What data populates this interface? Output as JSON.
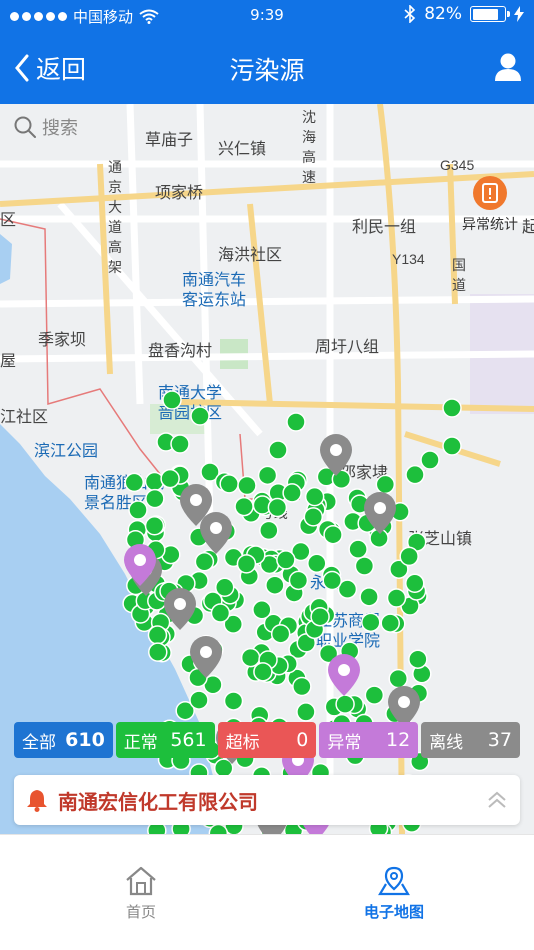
{
  "status_bar": {
    "carrier": "中国移动",
    "time": "9:39",
    "battery": "82%",
    "battery_level": 0.82
  },
  "nav": {
    "back_label": "返回",
    "title": "污染源"
  },
  "search": {
    "placeholder": "搜索"
  },
  "map": {
    "labels": [
      {
        "text": "草庙子",
        "type": "place"
      },
      {
        "text": "兴仁镇",
        "type": "place"
      },
      {
        "text": "沈海高速",
        "type": "road"
      },
      {
        "text": "项家桥",
        "type": "place"
      },
      {
        "text": "通京大道高架",
        "type": "road"
      },
      {
        "text": "G345",
        "type": "road"
      },
      {
        "text": "利民一组",
        "type": "place"
      },
      {
        "text": "Y134",
        "type": "road"
      },
      {
        "text": "海洪社区",
        "type": "place"
      },
      {
        "text": "南通汽车客运东站",
        "type": "poi"
      },
      {
        "text": "季家坝",
        "type": "place"
      },
      {
        "text": "盘香沟村",
        "type": "place"
      },
      {
        "text": "周圩八组",
        "type": "place"
      },
      {
        "text": "南通大学啬园校区",
        "type": "poi"
      },
      {
        "text": "江社区",
        "type": "place"
      },
      {
        "text": "滨江公园",
        "type": "poi"
      },
      {
        "text": "邵家埭",
        "type": "place"
      },
      {
        "text": "南通狼山风景名胜区",
        "type": "poi"
      },
      {
        "text": "张芝山镇",
        "type": "place"
      },
      {
        "text": "1号线",
        "type": "road"
      },
      {
        "text": "永旺",
        "type": "poi"
      },
      {
        "text": "江苏商贸职业学院",
        "type": "poi"
      },
      {
        "text": "沈海",
        "type": "road"
      },
      {
        "text": "国道",
        "type": "road"
      },
      {
        "text": "区",
        "type": "place"
      },
      {
        "text": "屋",
        "type": "place"
      },
      {
        "text": "起",
        "type": "place"
      }
    ],
    "stat_label": "异常统计"
  },
  "filters": [
    {
      "label": "全部",
      "count": "610",
      "color": "#1e74d2"
    },
    {
      "label": "正常",
      "count": "561",
      "color": "#1dbf3c"
    },
    {
      "label": "超标",
      "count": "0",
      "color": "#ea5656"
    },
    {
      "label": "异常",
      "count": "12",
      "color": "#c47ad9"
    },
    {
      "label": "离线",
      "count": "37",
      "color": "#8b8b8b"
    }
  ],
  "company": {
    "name": "南通宏信化工有限公司"
  },
  "tabs": [
    {
      "label": "首页",
      "icon": "home-icon",
      "active": false
    },
    {
      "label": "电子地图",
      "icon": "map-pin-icon",
      "active": true
    }
  ]
}
